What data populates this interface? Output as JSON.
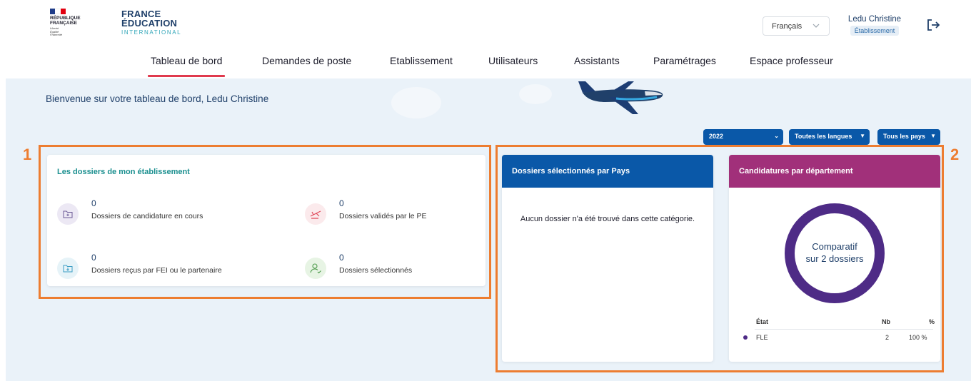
{
  "header": {
    "republique_lines": [
      "RÉPUBLIQUE",
      "FRANÇAISE"
    ],
    "republique_motto": [
      "Liberté",
      "Égalité",
      "Fraternité"
    ],
    "brand_line1": "FRANCE",
    "brand_line2": "ÉDUCATION",
    "brand_line3": "INTERNATIONAL",
    "language": "Français",
    "user_name": "Ledu Christine",
    "user_role": "Établissement"
  },
  "nav": {
    "items": [
      "Tableau de bord",
      "Demandes de poste",
      "Etablissement",
      "Utilisateurs",
      "Assistants",
      "Paramétrages",
      "Espace professeur"
    ],
    "active": "Tableau de bord"
  },
  "welcome": "Bienvenue sur votre tableau de bord, Ledu Christine",
  "filters": {
    "year": "2022",
    "languages": "Toutes les langues",
    "countries": "Tous les pays"
  },
  "card_dossiers": {
    "title": "Les dossiers de mon établissement",
    "stats": [
      {
        "value": "0",
        "label": "Dossiers de candidature en cours",
        "icon": "folder-plus-icon"
      },
      {
        "value": "0",
        "label": "Dossiers validés par le PE",
        "icon": "plane-icon"
      },
      {
        "value": "0",
        "label": "Dossiers reçus par FEI ou le partenaire",
        "icon": "folder-download-icon"
      },
      {
        "value": "0",
        "label": "Dossiers sélectionnés",
        "icon": "user-check-icon"
      }
    ]
  },
  "card_pays": {
    "title": "Dossiers sélectionnés par Pays",
    "empty_message": "Aucun dossier n'a été trouvé dans cette catégorie."
  },
  "card_departement": {
    "title": "Candidatures par département",
    "donut_line1": "Comparatif",
    "donut_line2": "sur 2 dossiers",
    "table_headers": {
      "state": "État",
      "count": "Nb",
      "percent": "%"
    },
    "rows": [
      {
        "state": "FLE",
        "count": "2",
        "percent": "100 %"
      }
    ]
  },
  "annotations": {
    "box1": "1",
    "box2": "2"
  },
  "colors": {
    "nav_active": "#e03a4e",
    "filter_bg": "#0a58a8",
    "card_pays_head": "#0a58a8",
    "card_departement_head": "#a1307a",
    "donut": "#4e2b86",
    "annotation": "#ed7d31",
    "teal_title": "#1a8f8f"
  }
}
